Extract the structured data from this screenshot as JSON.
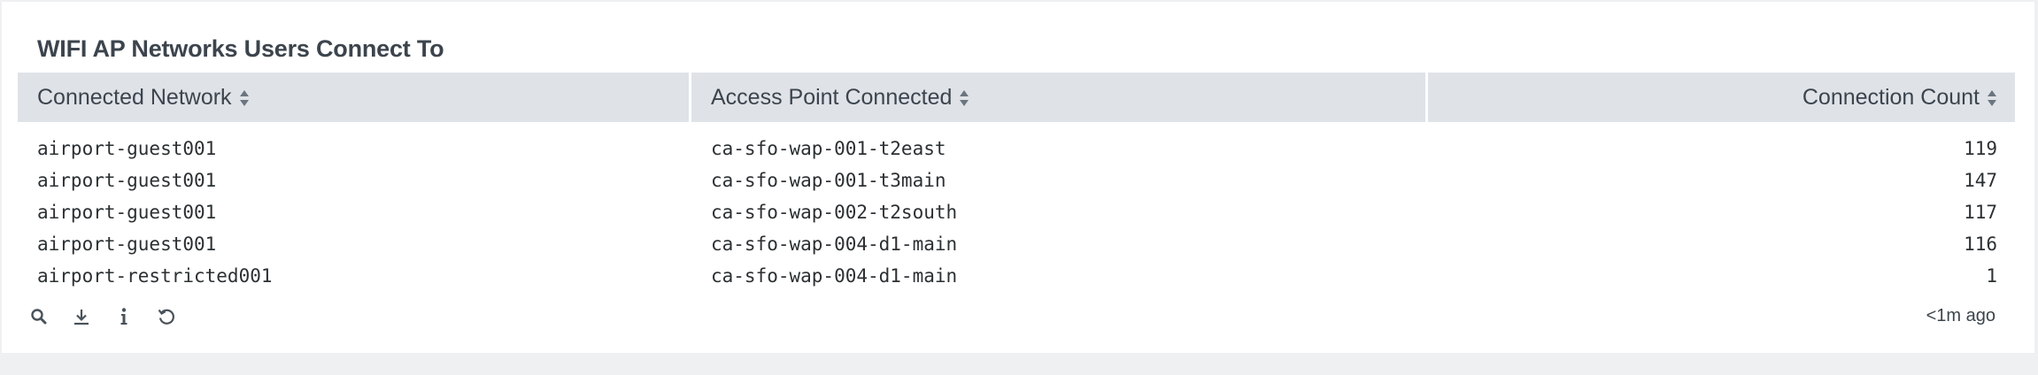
{
  "panel": {
    "title": "WIFI AP Networks Users Connect To",
    "updated": "<1m ago"
  },
  "table": {
    "columns": [
      {
        "label": "Connected Network",
        "sortable": true,
        "icon": "sort-icon"
      },
      {
        "label": "Access Point Connected",
        "sortable": true,
        "icon": "sort-icon"
      },
      {
        "label": "Connection Count",
        "sortable": true,
        "icon": "sort-icon"
      }
    ],
    "rows": [
      {
        "network": "airport-guest001",
        "access_point": "ca-sfo-wap-001-t2east",
        "count": "119"
      },
      {
        "network": "airport-guest001",
        "access_point": "ca-sfo-wap-001-t3main",
        "count": "147"
      },
      {
        "network": "airport-guest001",
        "access_point": "ca-sfo-wap-002-t2south",
        "count": "117"
      },
      {
        "network": "airport-guest001",
        "access_point": "ca-sfo-wap-004-d1-main",
        "count": "116"
      },
      {
        "network": "airport-restricted001",
        "access_point": "ca-sfo-wap-004-d1-main",
        "count": "1"
      }
    ]
  },
  "footer": {
    "icons": [
      "search-icon",
      "download-icon",
      "info-icon",
      "refresh-icon"
    ]
  },
  "colors": {
    "header_bg": "#dfe3e8",
    "text": "#3c444d",
    "page_bg": "#eef0f2"
  }
}
